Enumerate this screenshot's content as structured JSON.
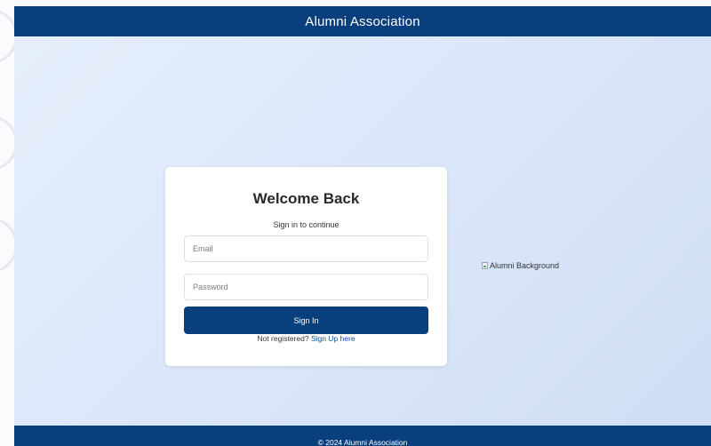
{
  "header": {
    "title": "Alumni Association"
  },
  "login_card": {
    "title": "Welcome Back",
    "subtitle": "Sign in to continue",
    "email_placeholder": "Email",
    "password_placeholder": "Password",
    "submit_label": "Sign In",
    "register_prompt": "Not registered?",
    "register_link": "Sign Up here"
  },
  "background_image": {
    "alt": "Alumni Background"
  },
  "footer": {
    "copyright": "© 2024 Alumni Association"
  },
  "colors": {
    "brand": "#083f7c",
    "link": "#0d4d96",
    "background": "#dbe6f9"
  }
}
